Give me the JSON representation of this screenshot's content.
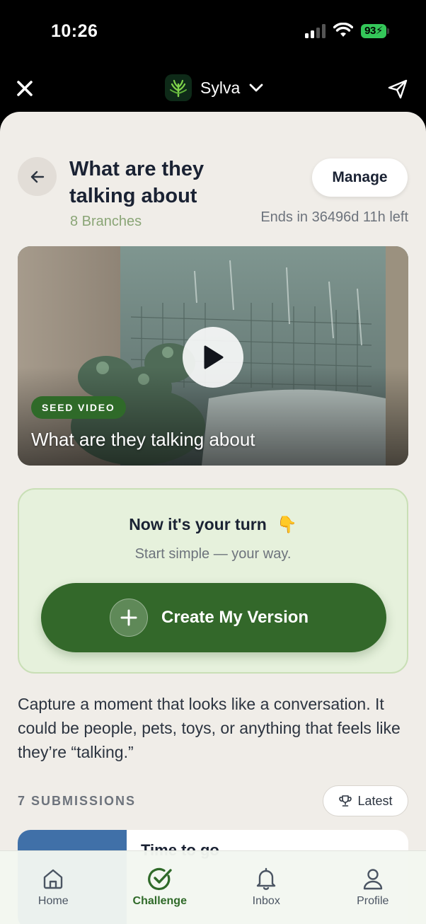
{
  "status_bar": {
    "time": "10:26",
    "battery": "93"
  },
  "nav": {
    "community_name": "Sylva"
  },
  "header": {
    "title": "What are they talking about",
    "branches": "8 Branches",
    "manage_label": "Manage",
    "ends_text": "Ends in 36496d 11h left"
  },
  "video": {
    "badge": "SEED VIDEO",
    "title": "What are they talking about"
  },
  "turn_card": {
    "title": "Now it's your turn",
    "emoji": "👇",
    "subtitle": "Start simple — your way.",
    "button_label": "Create My Version"
  },
  "description": "Capture a moment that looks like a conversation. It could be people, pets, toys, or anything that feels like they’re “talking.”",
  "submissions": {
    "label": "7 SUBMISSIONS",
    "sort_label": "Latest",
    "first_item_title": "Time to go"
  },
  "tab_bar": {
    "tabs": [
      {
        "label": "Home",
        "icon": "home-icon",
        "active": false
      },
      {
        "label": "Challenge",
        "icon": "check-circle-icon",
        "active": true
      },
      {
        "label": "Inbox",
        "icon": "bell-icon",
        "active": false
      },
      {
        "label": "Profile",
        "icon": "person-icon",
        "active": false
      }
    ]
  },
  "colors": {
    "accent_green": "#2f6a29",
    "sheet_bg": "#f0ede8",
    "card_green": "#e6f1dc"
  }
}
